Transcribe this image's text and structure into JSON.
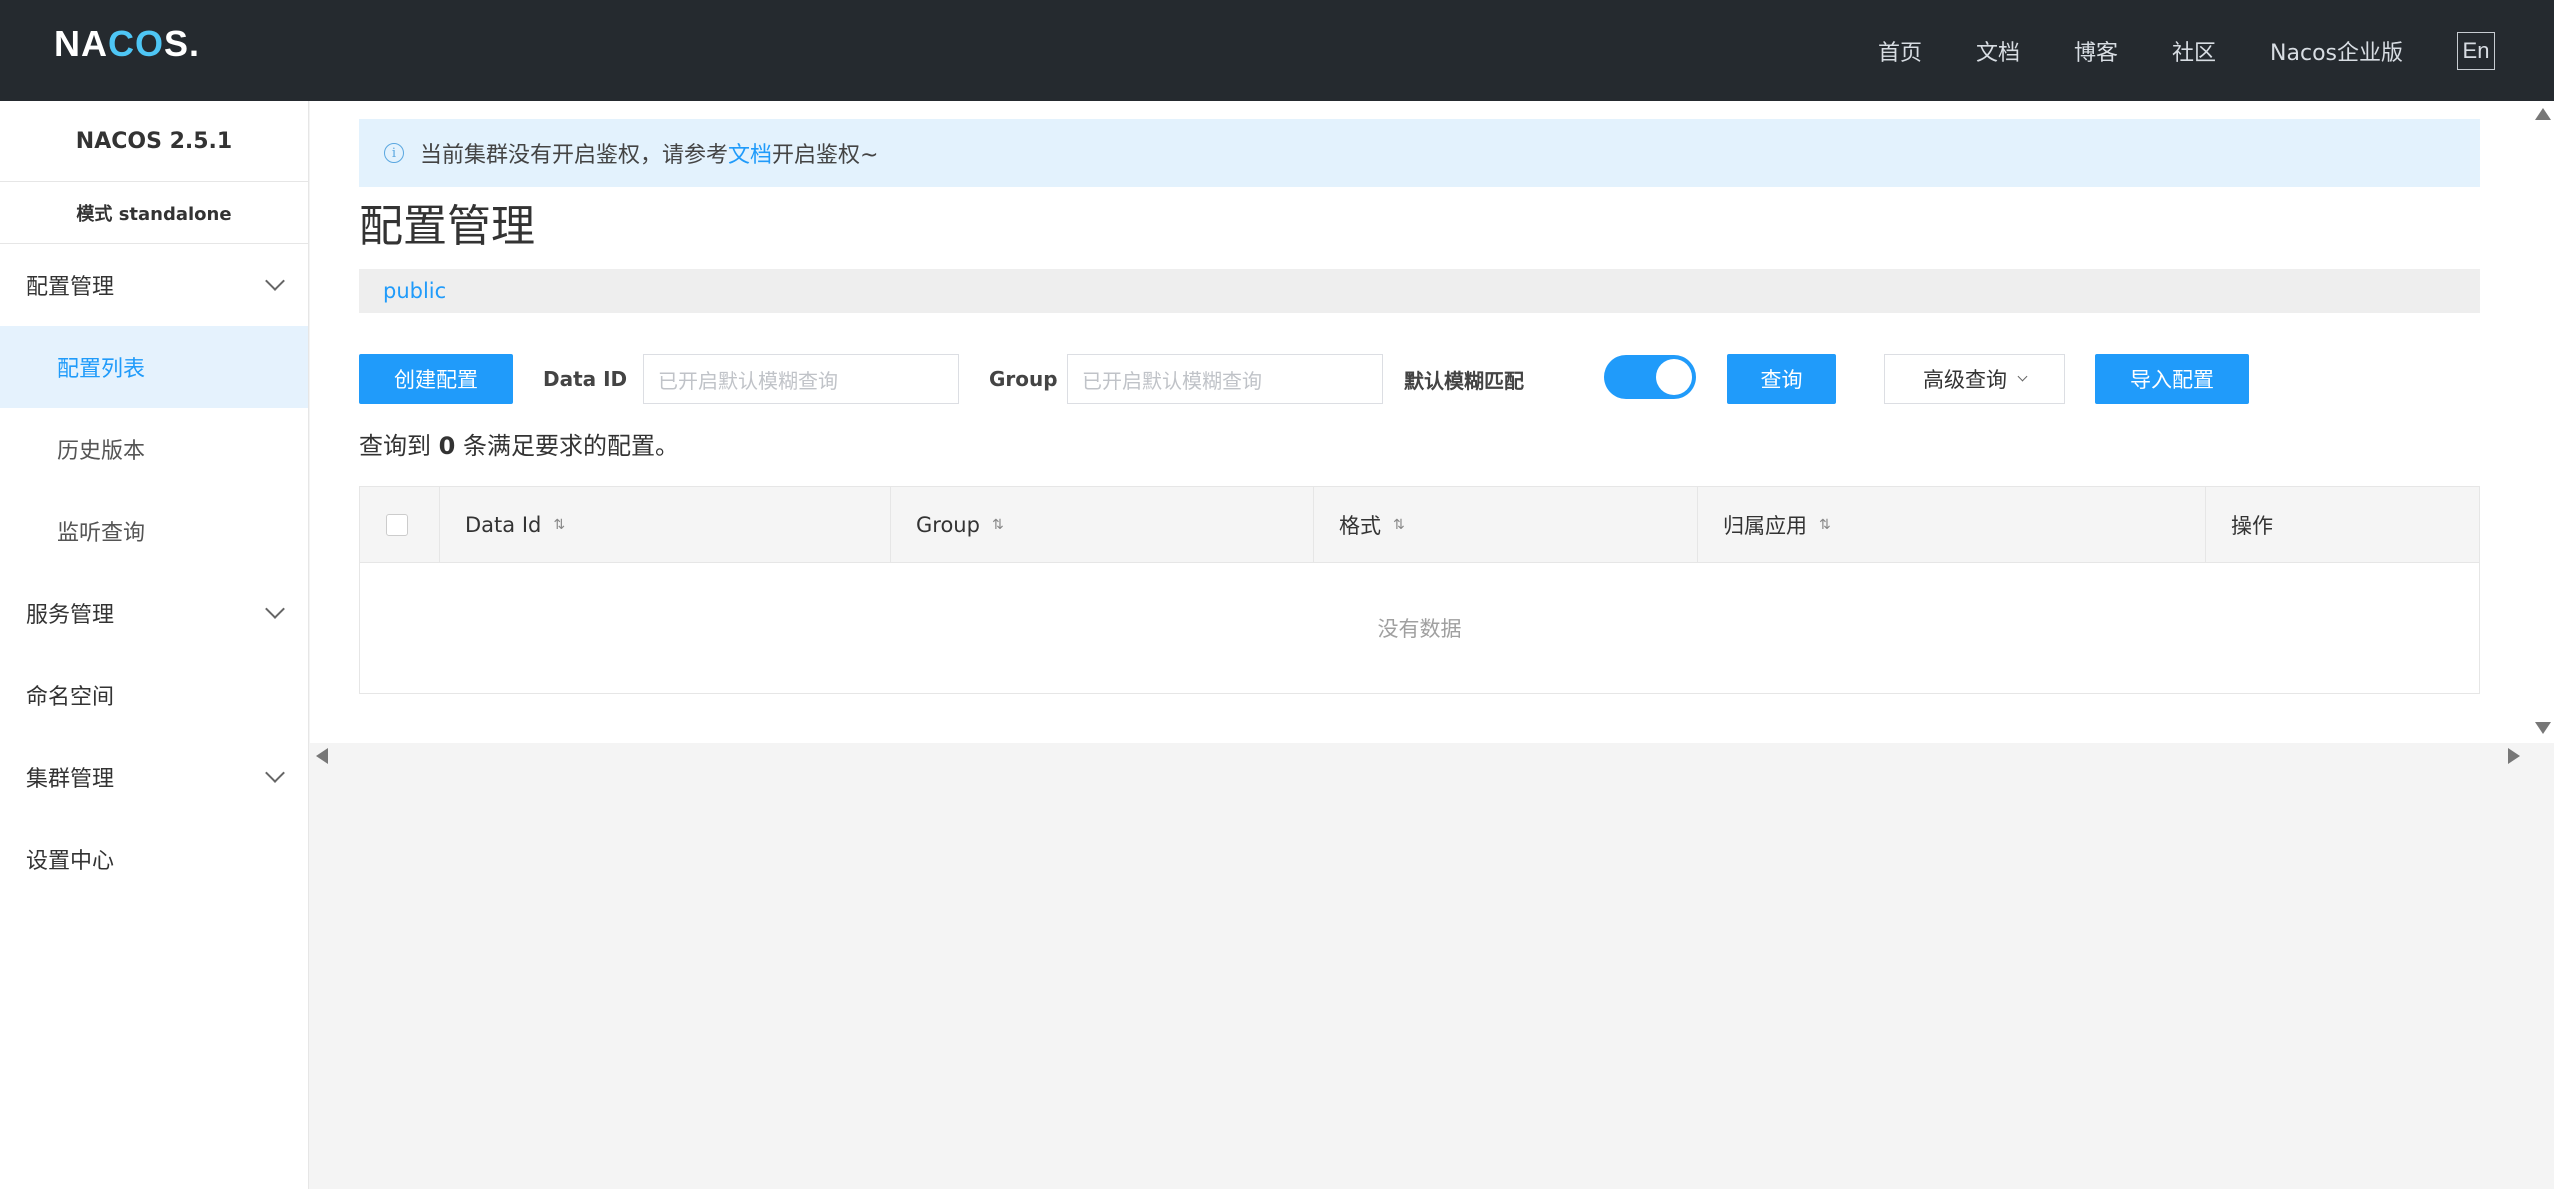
{
  "header": {
    "logo_prefix": "NA",
    "logo_co": "CO",
    "logo_suffix": "S.",
    "nav": [
      "首页",
      "文档",
      "博客",
      "社区",
      "Nacos企业版"
    ],
    "lang": "En"
  },
  "sidebar": {
    "version": "NACOS 2.5.1",
    "mode": "模式 standalone",
    "config_group": "配置管理",
    "config_items": [
      "配置列表",
      "历史版本",
      "监听查询"
    ],
    "service_group": "服务管理",
    "namespace": "命名空间",
    "cluster_group": "集群管理",
    "settings": "设置中心"
  },
  "notice": {
    "text_before": "当前集群没有开启鉴权，请参考",
    "link": "文档",
    "text_after": "开启鉴权~"
  },
  "page_title": "配置管理",
  "namespace_tab": "public",
  "toolbar": {
    "create_label": "创建配置",
    "dataid_label": "Data ID",
    "dataid_placeholder": "已开启默认模糊查询",
    "group_label": "Group",
    "group_placeholder": "已开启默认模糊查询",
    "fuzzy_label": "默认模糊匹配",
    "fuzzy_on": true,
    "search_label": "查询",
    "advanced_label": "高级查询",
    "import_label": "导入配置"
  },
  "result": {
    "prefix": "查询到",
    "count": "0",
    "suffix": "条满足要求的配置。"
  },
  "table": {
    "columns": [
      "Data Id",
      "Group",
      "格式",
      "归属应用",
      "操作"
    ],
    "empty_text": "没有数据"
  },
  "colors": {
    "primary": "#209bfa",
    "header_bg": "#252a2f",
    "notice_bg": "#e3f2fd"
  }
}
